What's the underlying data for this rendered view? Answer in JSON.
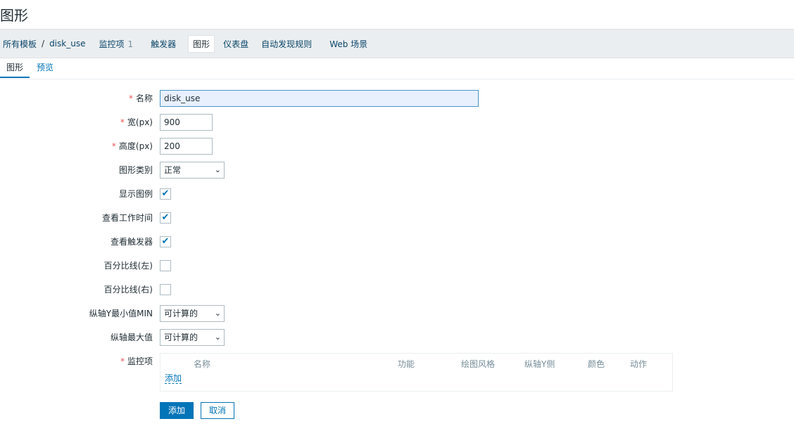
{
  "page": {
    "title": "图形"
  },
  "breadcrumb": {
    "all_templates": "所有模板",
    "separator": "/",
    "template": "disk_use"
  },
  "nav_tabs": {
    "items_label": "监控项",
    "items_count": "1",
    "triggers": "触发器",
    "graphs": "图形",
    "dashboards": "仪表盘",
    "discovery": "自动发现规则",
    "web": "Web 场景"
  },
  "subtabs": {
    "graph": "图形",
    "preview": "预览"
  },
  "form": {
    "name": {
      "label": "名称",
      "value": "disk_use"
    },
    "width": {
      "label": "宽(px)",
      "value": "900"
    },
    "height": {
      "label": "高度(px)",
      "value": "200"
    },
    "graph_type": {
      "label": "图形类别",
      "value": "正常"
    },
    "show_legend": {
      "label": "显示图例",
      "checked": true
    },
    "show_working_time": {
      "label": "查看工作时间",
      "checked": true
    },
    "show_triggers": {
      "label": "查看触发器",
      "checked": true
    },
    "percentile_left": {
      "label": "百分比线(左)",
      "checked": false
    },
    "percentile_right": {
      "label": "百分比线(右)",
      "checked": false
    },
    "ymin": {
      "label": "纵轴Y最小值MIN",
      "value": "可计算的"
    },
    "ymax": {
      "label": "纵轴最大值",
      "value": "可计算的"
    },
    "items": {
      "label": "监控项",
      "columns": [
        "名称",
        "功能",
        "绘图风格",
        "纵轴Y侧",
        "颜色",
        "动作"
      ],
      "add": "添加"
    }
  },
  "buttons": {
    "add": "添加",
    "cancel": "取消"
  },
  "check_mark": "✔",
  "required_mark": "*",
  "chevron": "⌄"
}
